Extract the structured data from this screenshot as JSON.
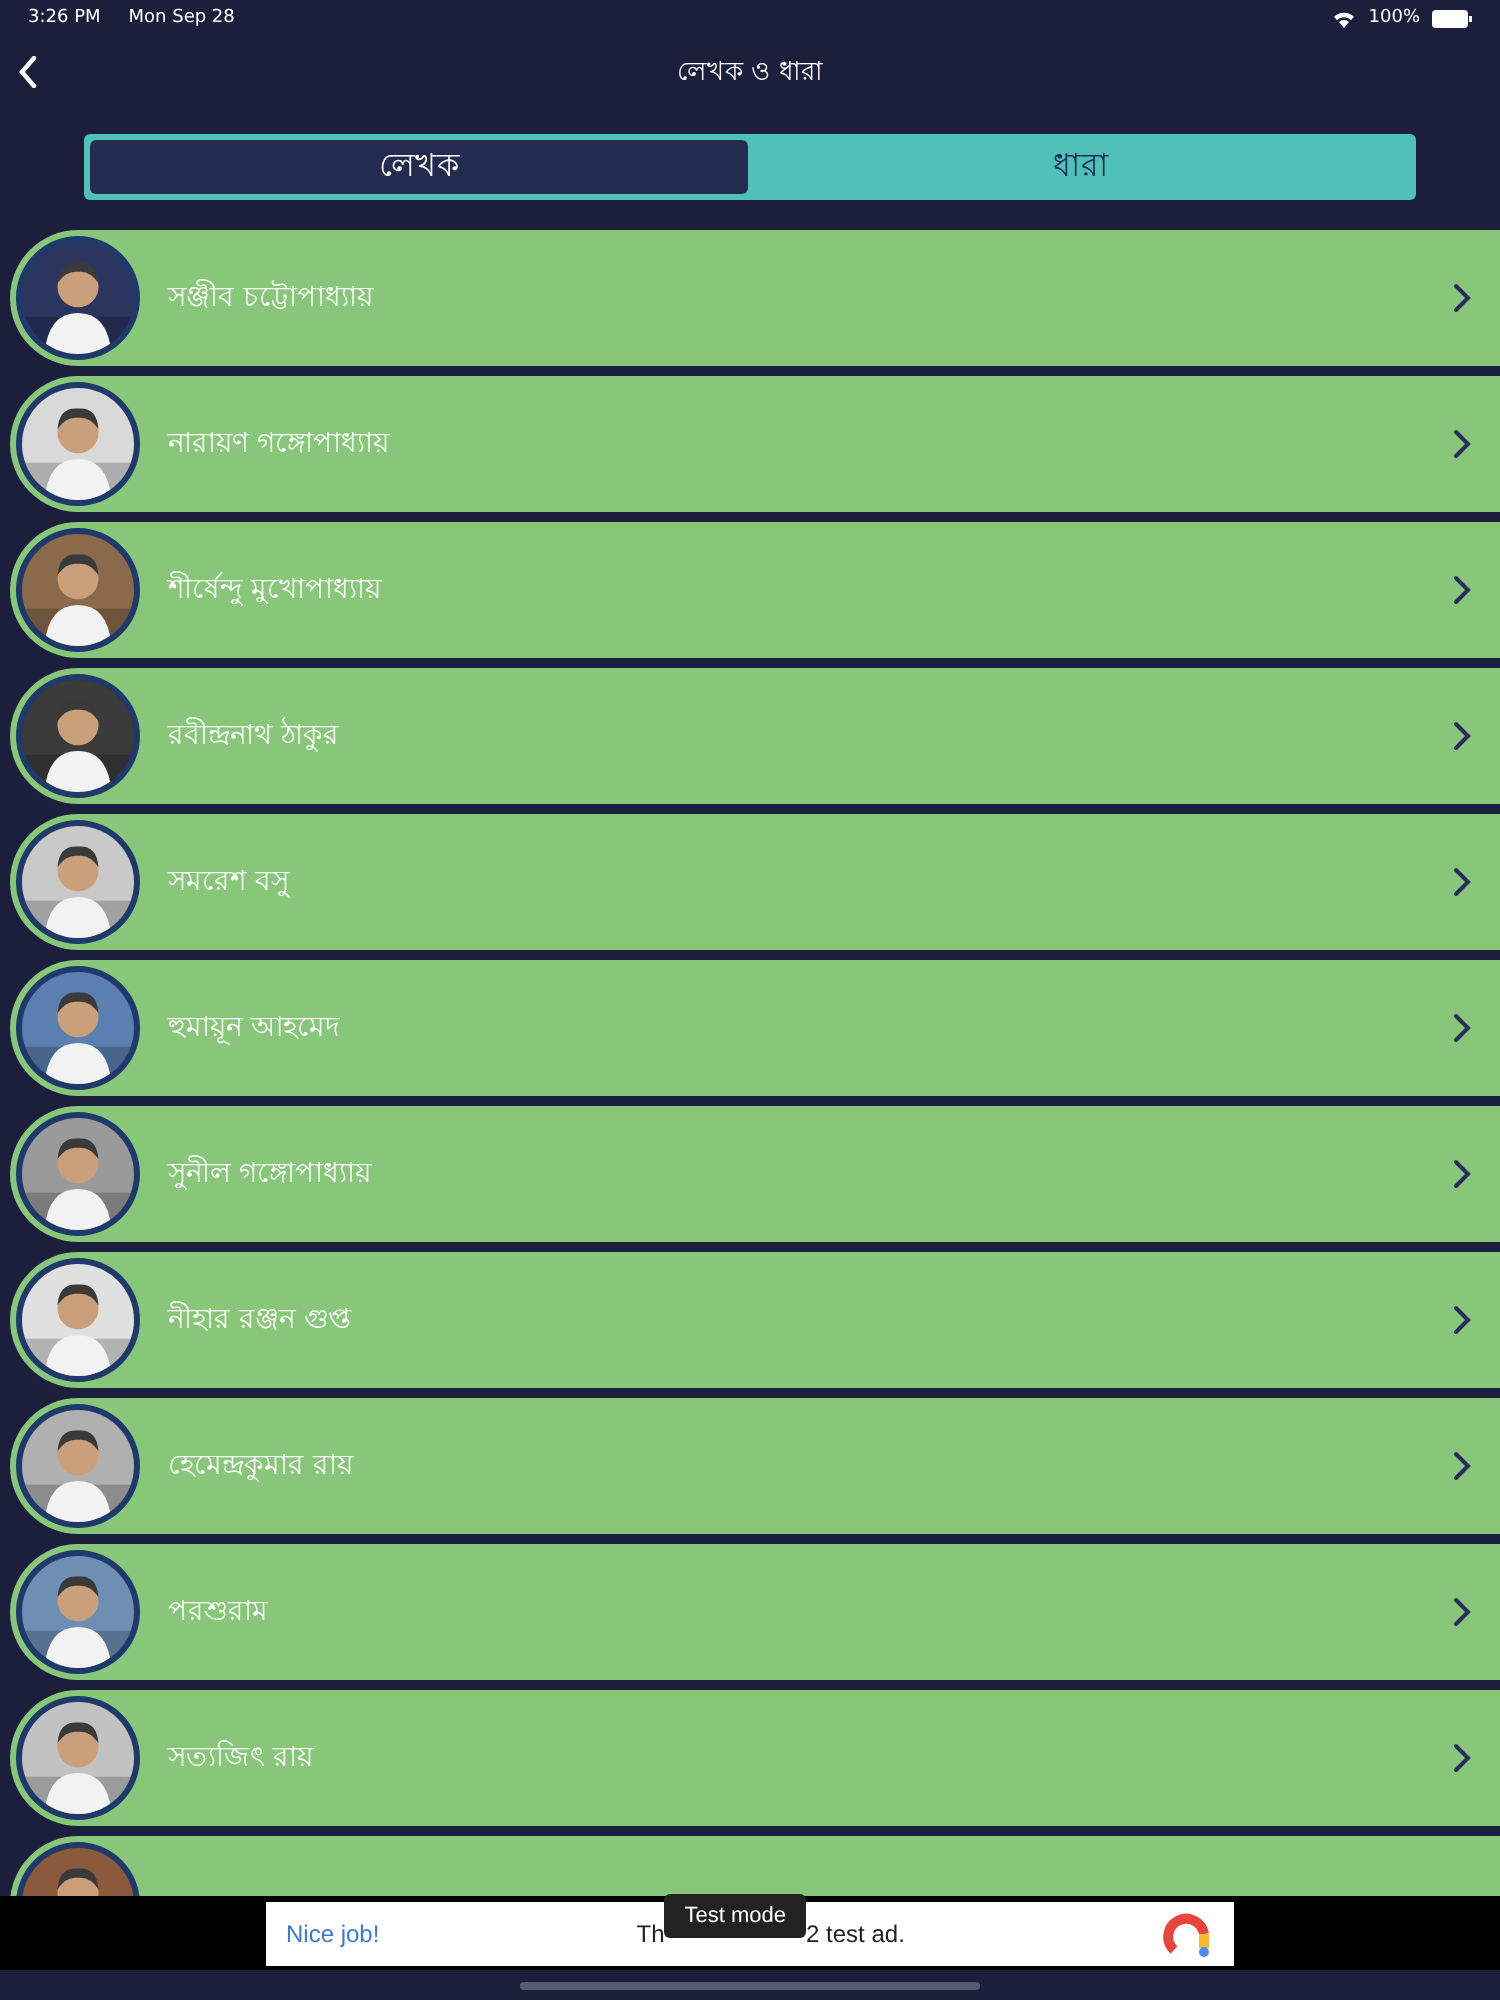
{
  "status_bar": {
    "time": "3:26 PM",
    "date": "Mon Sep 28",
    "battery": "100%"
  },
  "nav": {
    "title": "লেখক ও ধারা"
  },
  "tabs": [
    {
      "label": "লেখক",
      "selected": true
    },
    {
      "label": "ধারা",
      "selected": false
    }
  ],
  "authors": [
    {
      "name": "সঞ্জীব চট্টোপাধ্যায়",
      "avatar": {
        "kind": "picture"
      }
    },
    {
      "name": "নারায়ণ গঙ্গোপাধ্যায়",
      "avatar": {
        "kind": "picture"
      }
    },
    {
      "name": "শীর্ষেন্দু মুখোপাধ্যায়",
      "avatar": {
        "kind": "picture"
      }
    },
    {
      "name": "রবীন্দ্রনাথ ঠাকুর",
      "avatar": {
        "kind": "picture"
      }
    },
    {
      "name": "সমরেশ বসু",
      "avatar": {
        "kind": "picture"
      }
    },
    {
      "name": "হুমায়ূন আহমেদ",
      "avatar": {
        "kind": "picture"
      }
    },
    {
      "name": "সুনীল গঙ্গোপাধ্যায়",
      "avatar": {
        "kind": "picture"
      }
    },
    {
      "name": "নীহার রঞ্জন গুপ্ত",
      "avatar": {
        "kind": "picture"
      }
    },
    {
      "name": "হেমেন্দ্রকুমার রায়",
      "avatar": {
        "kind": "picture"
      }
    },
    {
      "name": "পরশুরাম",
      "avatar": {
        "kind": "picture"
      }
    },
    {
      "name": "সত্যজিৎ রায়",
      "avatar": {
        "kind": "picture"
      }
    },
    {
      "avatar": {
        "kind": "picture"
      }
    }
  ],
  "ad": {
    "headline": "Nice job!",
    "text_start": "Th",
    "text_end": "2 test ad.",
    "badge": "Test mode"
  }
}
